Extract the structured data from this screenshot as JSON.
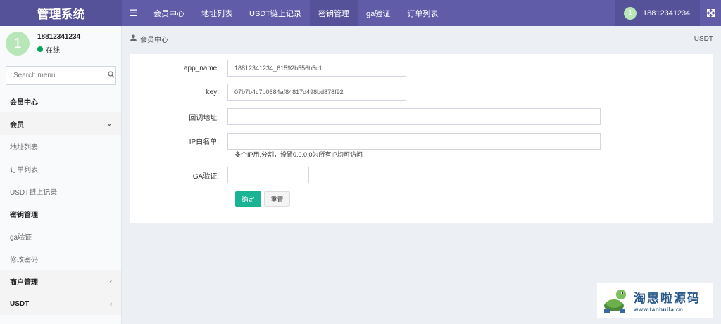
{
  "app": {
    "title": "管理系统"
  },
  "nav": {
    "items": [
      {
        "label": "会员中心"
      },
      {
        "label": "地址列表"
      },
      {
        "label": "USDT链上记录"
      },
      {
        "label": "密钥管理"
      },
      {
        "label": "ga验证"
      },
      {
        "label": "订单列表"
      }
    ],
    "active_index": 3
  },
  "user": {
    "avatar_letter": "1",
    "name": "18812341234",
    "status": "在线"
  },
  "search": {
    "placeholder": "Search menu"
  },
  "menu": {
    "items": [
      {
        "label": "会员中心",
        "kind": "header"
      },
      {
        "label": "会员",
        "kind": "parent",
        "caret": "⌄"
      },
      {
        "label": "地址列表",
        "kind": "sub"
      },
      {
        "label": "订单列表",
        "kind": "sub"
      },
      {
        "label": "USDT链上记录",
        "kind": "sub"
      },
      {
        "label": "密钥管理",
        "kind": "sub-active"
      },
      {
        "label": "ga验证",
        "kind": "sub"
      },
      {
        "label": "修改密码",
        "kind": "sub"
      },
      {
        "label": "商户管理",
        "kind": "parent",
        "caret": "‹"
      },
      {
        "label": "USDT",
        "kind": "parent",
        "caret": "‹"
      }
    ]
  },
  "breadcrumb": {
    "current": "会员中心",
    "right": "USDT"
  },
  "form": {
    "app_name_label": "app_name:",
    "app_name_value": "18812341234_61592b556b5c1",
    "key_label": "key:",
    "key_value": "07b7b4c7b0684af84817d498bd878f92",
    "callback_label": "回调地址:",
    "callback_value": "",
    "ip_whitelist_label": "IP白名单:",
    "ip_whitelist_value": "",
    "ip_hint": "多个IP用,分割，设置0.0.0.0为所有IP均可访问",
    "ga_label": "GA验证:",
    "ga_value": "",
    "submit_label": "确定",
    "reset_label": "重置"
  },
  "watermark": {
    "title": "淘惠啦源码",
    "url": "www.taohuila.cn"
  },
  "colors": {
    "topbar": "#605ca8",
    "topbar_dark": "#555299",
    "accent": "#1ab394",
    "online": "#00a65a"
  },
  "icons": {
    "menu": "hamburger-icon",
    "search": "search-icon",
    "expand": "expand-icon",
    "user": "user-icon"
  }
}
